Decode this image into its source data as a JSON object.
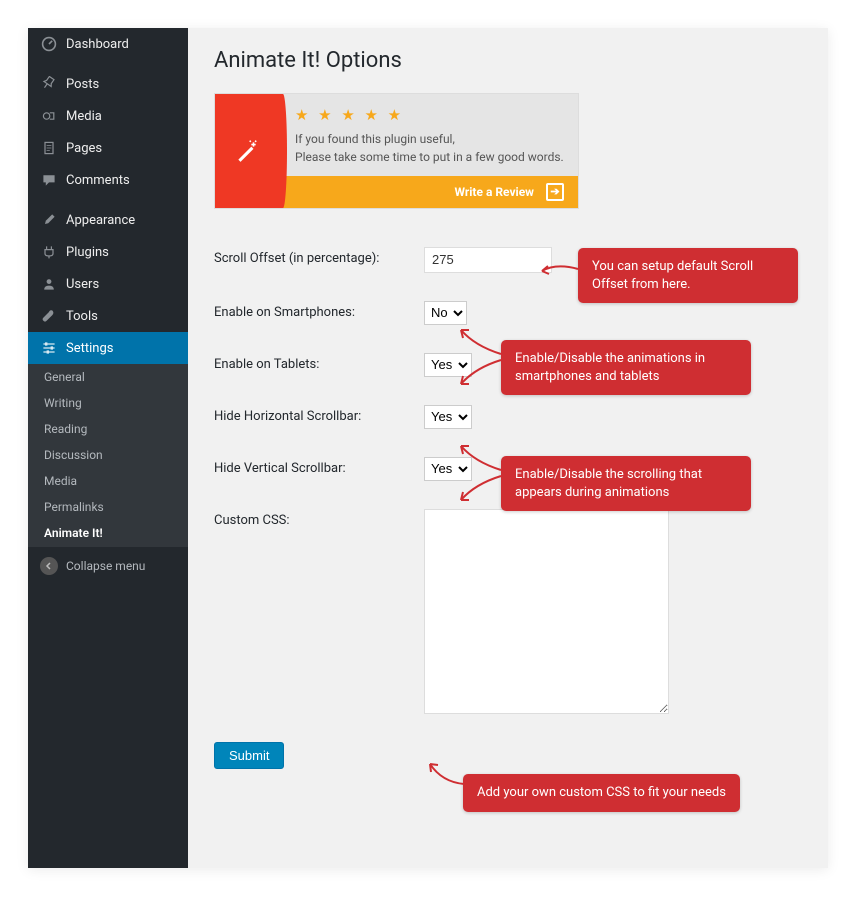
{
  "sidebar": {
    "items": [
      {
        "label": "Dashboard",
        "icon": "dashboard"
      },
      {
        "label": "Posts",
        "icon": "pin"
      },
      {
        "label": "Media",
        "icon": "media"
      },
      {
        "label": "Pages",
        "icon": "pages"
      },
      {
        "label": "Comments",
        "icon": "comments"
      },
      {
        "label": "Appearance",
        "icon": "brush"
      },
      {
        "label": "Plugins",
        "icon": "plug"
      },
      {
        "label": "Users",
        "icon": "user"
      },
      {
        "label": "Tools",
        "icon": "wrench"
      },
      {
        "label": "Settings",
        "icon": "sliders"
      }
    ],
    "submenu": [
      "General",
      "Writing",
      "Reading",
      "Discussion",
      "Media",
      "Permalinks",
      "Animate It!"
    ],
    "collapse": "Collapse menu"
  },
  "page": {
    "title": "Animate It! Options",
    "review": {
      "line1": "If you found this plugin useful,",
      "line2": "Please take some time to put in a few good words.",
      "cta": "Write a Review"
    },
    "form": {
      "scroll_label": "Scroll Offset (in percentage):",
      "scroll_value": "275",
      "smart_label": "Enable on Smartphones:",
      "smart_value": "No",
      "tablet_label": "Enable on Tablets:",
      "tablet_value": "Yes",
      "hscroll_label": "Hide Horizontal Scrollbar:",
      "hscroll_value": "Yes",
      "vscroll_label": "Hide Vertical Scrollbar:",
      "vscroll_value": "Yes",
      "css_label": "Custom CSS:",
      "css_value": "",
      "submit": "Submit",
      "options": [
        "Yes",
        "No"
      ]
    }
  },
  "annotations": {
    "a1": "You can setup default Scroll Offset from here.",
    "a2": "Enable/Disable the animations in smartphones and tablets",
    "a3": "Enable/Disable the scrolling that appears during animations",
    "a4": "Add your own custom CSS to fit your needs"
  }
}
